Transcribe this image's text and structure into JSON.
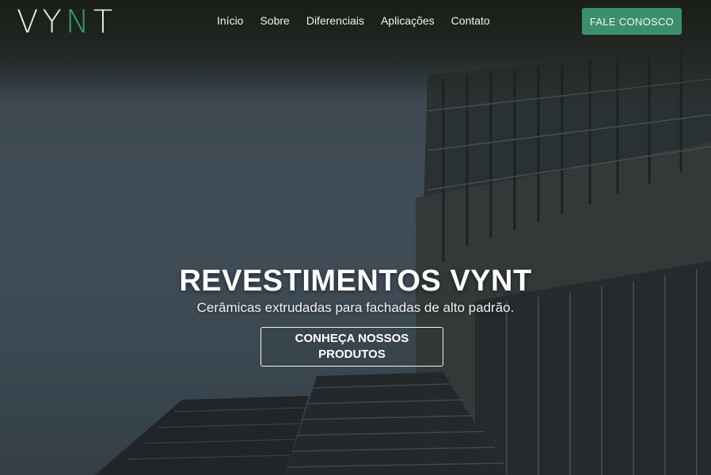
{
  "header": {
    "logo": {
      "prefix": "VY",
      "accent": "N",
      "suffix": "T"
    },
    "nav": [
      "Início",
      "Sobre",
      "Diferenciais",
      "Aplicações",
      "Contato"
    ],
    "cta_label": "FALE CONOSCO"
  },
  "hero": {
    "title": "REVESTIMENTOS VYNT",
    "subtitle": "Cerâmicas extrudadas para fachadas de alto padrão.",
    "button_label": "CONHEÇA NOSSOS PRODUTOS"
  },
  "colors": {
    "accent": "#3c8f6d",
    "logo_accent": "#3a9b6e"
  },
  "icons": {
    "hero_background": "building-facade-image"
  }
}
